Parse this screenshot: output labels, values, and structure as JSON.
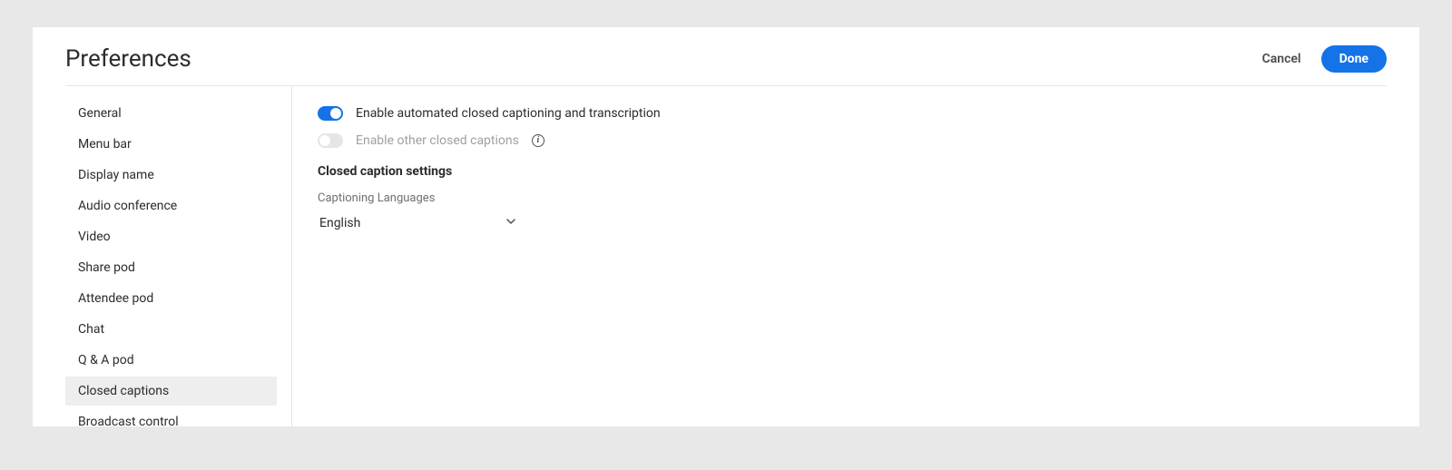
{
  "header": {
    "title": "Preferences",
    "cancel_label": "Cancel",
    "done_label": "Done"
  },
  "sidebar": {
    "items": [
      {
        "label": "General",
        "selected": false
      },
      {
        "label": "Menu bar",
        "selected": false
      },
      {
        "label": "Display name",
        "selected": false
      },
      {
        "label": "Audio conference",
        "selected": false
      },
      {
        "label": "Video",
        "selected": false
      },
      {
        "label": "Share pod",
        "selected": false
      },
      {
        "label": "Attendee pod",
        "selected": false
      },
      {
        "label": "Chat",
        "selected": false
      },
      {
        "label": "Q & A pod",
        "selected": false
      },
      {
        "label": "Closed captions",
        "selected": true
      },
      {
        "label": "Broadcast control",
        "selected": false
      }
    ]
  },
  "content": {
    "option1_label": "Enable automated closed captioning and transcription",
    "option1_on": true,
    "option2_label": "Enable other closed captions",
    "option2_on": false,
    "option2_disabled": true,
    "section_heading": "Closed caption settings",
    "lang_field_label": "Captioning Languages",
    "lang_selected": "English"
  }
}
